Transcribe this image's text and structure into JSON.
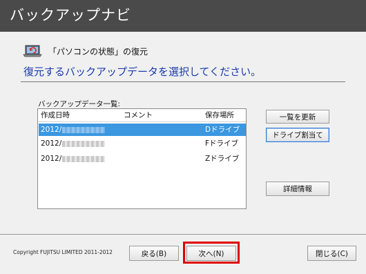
{
  "app": {
    "title": "バックアップナビ"
  },
  "header": {
    "icon": "laptop-restore-icon",
    "label": "「パソコンの状態」の復元",
    "instruction": "復元するバックアップデータを選択してください。"
  },
  "backup_list": {
    "label": "バックアップデータ一覧:",
    "columns": [
      "作成日時",
      "コメント",
      "保存場所"
    ],
    "rows": [
      {
        "date": "2012/",
        "comment": "",
        "location": "Dドライブ",
        "selected": true
      },
      {
        "date": "2012/",
        "comment": "",
        "location": "Fドライブ",
        "selected": false
      },
      {
        "date": "2012/",
        "comment": "",
        "location": "Zドライブ",
        "selected": false
      }
    ]
  },
  "side_buttons": {
    "refresh": "一覧を更新",
    "assign_drive": "ドライブ割当て",
    "details": "詳細情報"
  },
  "footer": {
    "copyright": "Copyright FUJITSU LIMITED 2011-2012",
    "back": "戻る(B)",
    "next": "次へ(N)",
    "close": "閉じる(C)"
  },
  "colors": {
    "titlebar": "#4a4a4a",
    "instruction_text": "#1a3aaa",
    "selected_row": "#3a97e0",
    "highlight_border": "#e00000"
  }
}
